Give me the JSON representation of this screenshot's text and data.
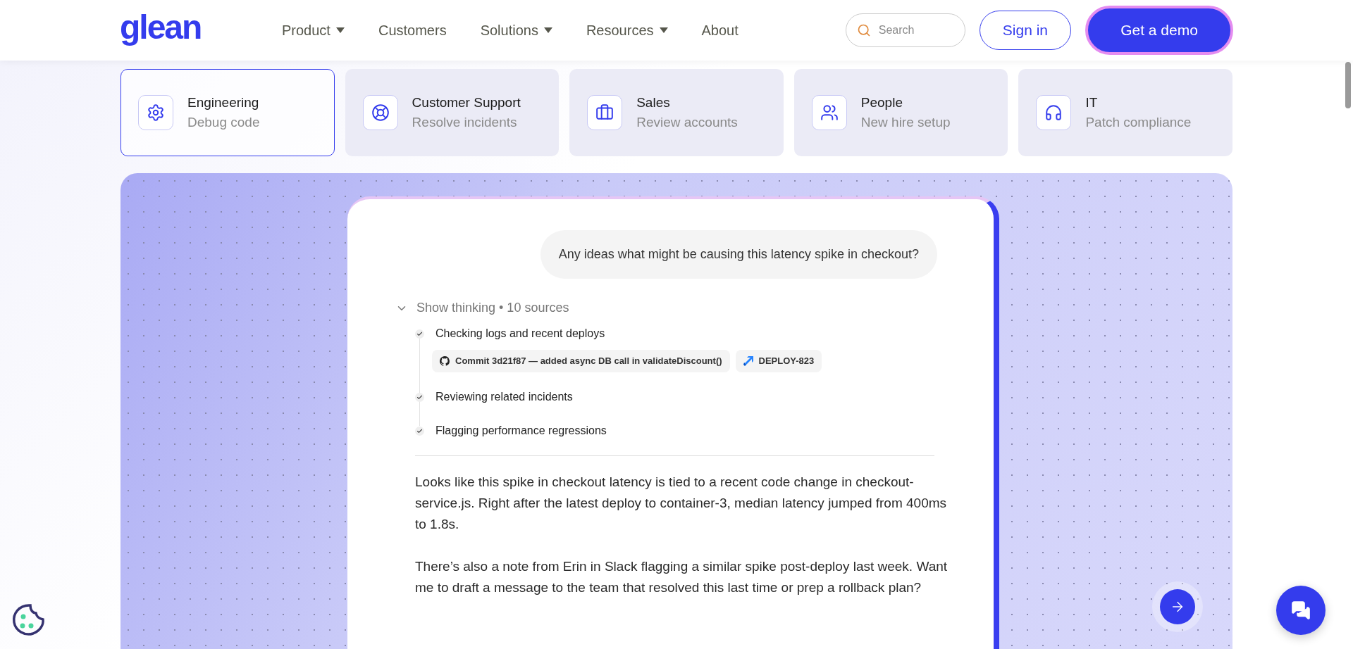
{
  "header": {
    "logo": "glean",
    "nav": [
      {
        "label": "Product",
        "dropdown": true
      },
      {
        "label": "Customers",
        "dropdown": false
      },
      {
        "label": "Solutions",
        "dropdown": true
      },
      {
        "label": "Resources",
        "dropdown": true
      },
      {
        "label": "About",
        "dropdown": false
      }
    ],
    "search": {
      "placeholder": "Search"
    },
    "sign_in": "Sign in",
    "demo": "Get a demo"
  },
  "use_cases": [
    {
      "kind": "gear",
      "title": "Engineering",
      "subtitle": "Debug code",
      "selected": true
    },
    {
      "kind": "lifebuoy",
      "title": "Customer Support",
      "subtitle": "Resolve incidents",
      "selected": false
    },
    {
      "kind": "briefcase",
      "title": "Sales",
      "subtitle": "Review accounts",
      "selected": false
    },
    {
      "kind": "people",
      "title": "People",
      "subtitle": "New hire setup",
      "selected": false
    },
    {
      "kind": "headset",
      "title": "IT",
      "subtitle": "Patch compliance",
      "selected": false
    }
  ],
  "chat": {
    "question": "Any ideas what might be causing this latency spike in checkout?",
    "thinking": {
      "label": "Show thinking • 10 sources",
      "expanded": true,
      "steps": [
        {
          "text": "Checking logs and recent deploys",
          "done": true,
          "sources": [
            {
              "kind": "github",
              "label": "Commit 3d21f87 — added async DB call in validateDiscount()"
            },
            {
              "kind": "jira",
              "label": "DEPLOY-823"
            }
          ]
        },
        {
          "text": "Reviewing related incidents",
          "done": true
        },
        {
          "text": "Flagging performance regressions",
          "done": true
        }
      ]
    },
    "answer": [
      "Looks like this spike in checkout latency is tied to a recent code change in checkout-service.js. Right after the latest deploy to container-3, median latency jumped from 400ms to 1.8s.",
      "There’s also a note from Erin in Slack flagging a similar spike post-deploy last week. Want me to draft a message to the team that resolved this last time or prep a rollback plan?"
    ]
  }
}
